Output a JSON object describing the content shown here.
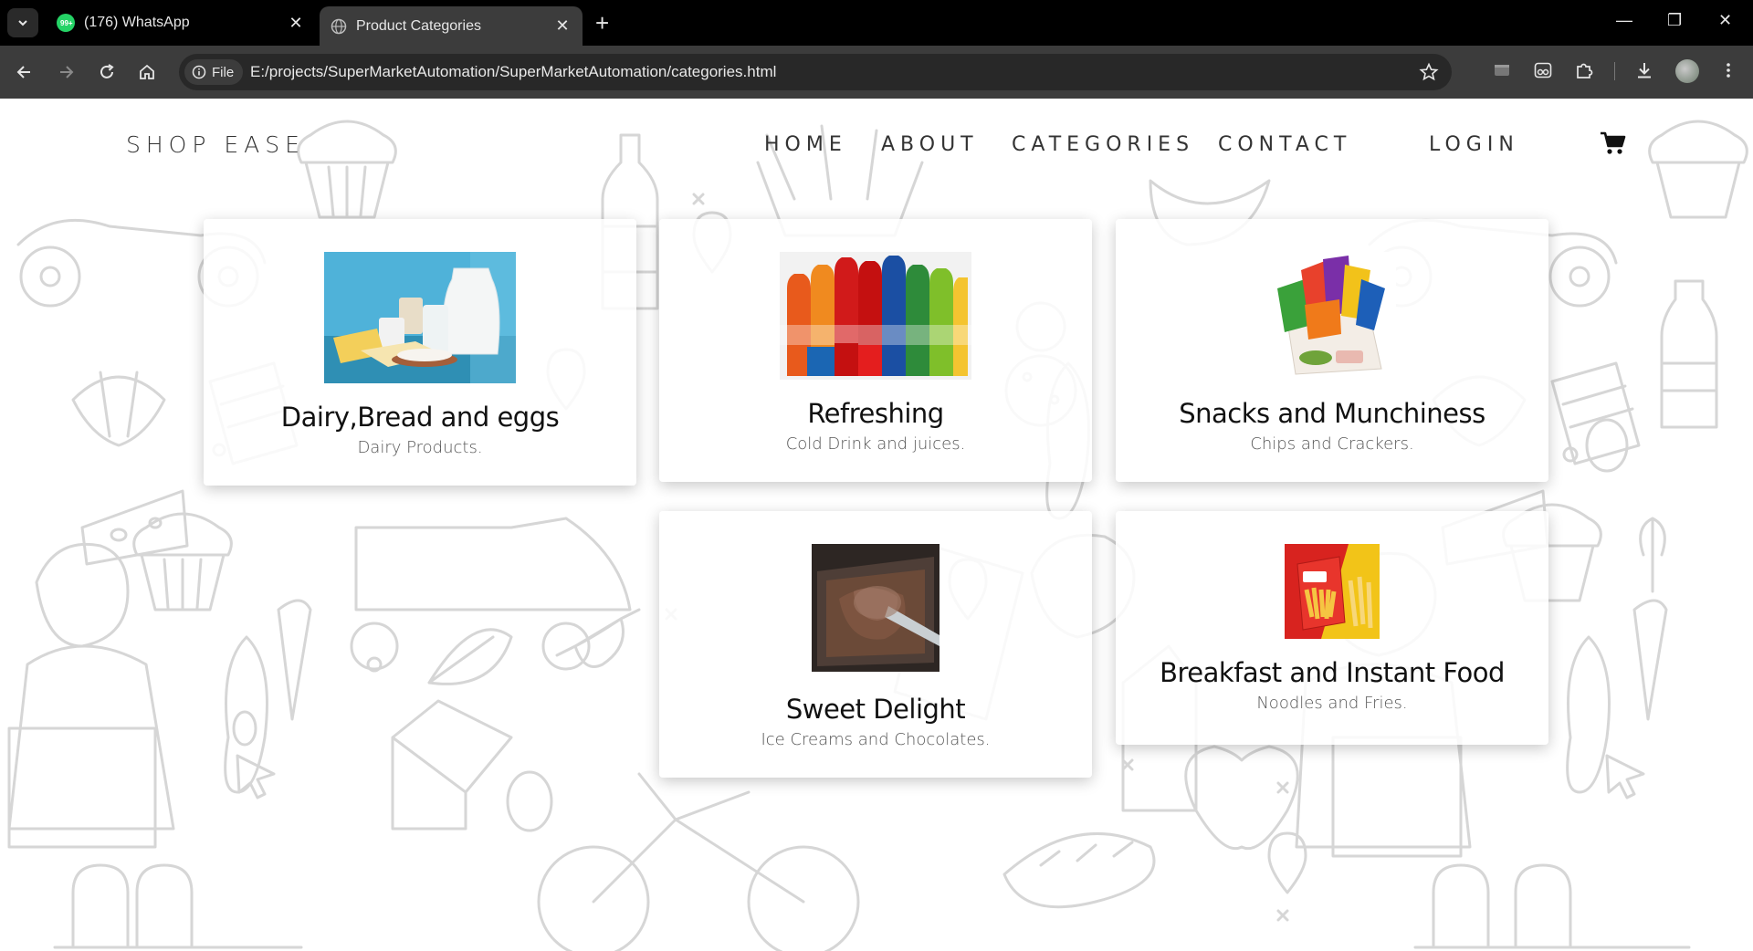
{
  "browser": {
    "tabs": [
      {
        "title": "(176) WhatsApp",
        "badge": "99+",
        "active": false
      },
      {
        "title": "Product Categories",
        "active": true
      }
    ],
    "file_label": "File",
    "url": "E:/projects/SuperMarketAutomation/SuperMarketAutomation/categories.html"
  },
  "site": {
    "brand": "SHOP EASE",
    "nav": {
      "home": "HOME",
      "about": "ABOUT",
      "categories": "CATEGORIES",
      "contact": "CONTACT",
      "login": "LOGIN"
    }
  },
  "categories": [
    {
      "title": "Dairy,Bread and eggs",
      "subtitle": "Dairy Products.",
      "image": "dairy-photo"
    },
    {
      "title": "Refreshing",
      "subtitle": "Cold Drink and juices.",
      "image": "soft-drinks-photo"
    },
    {
      "title": "Snacks and Munchiness",
      "subtitle": "Chips and Crackers.",
      "image": "snacks-box-photo"
    },
    {
      "title": "Sweet Delight",
      "subtitle": "Ice Creams and Chocolates.",
      "image": "ice-cream-photo"
    },
    {
      "title": "Breakfast and Instant Food",
      "subtitle": "Noodles and Fries.",
      "image": "fries-pack-photo"
    }
  ],
  "colors": {
    "chrome_dark": "#000000",
    "toolbar": "#3c3c3c",
    "nav_text": "#333333",
    "doodle_stroke": "#d6d6d6"
  }
}
